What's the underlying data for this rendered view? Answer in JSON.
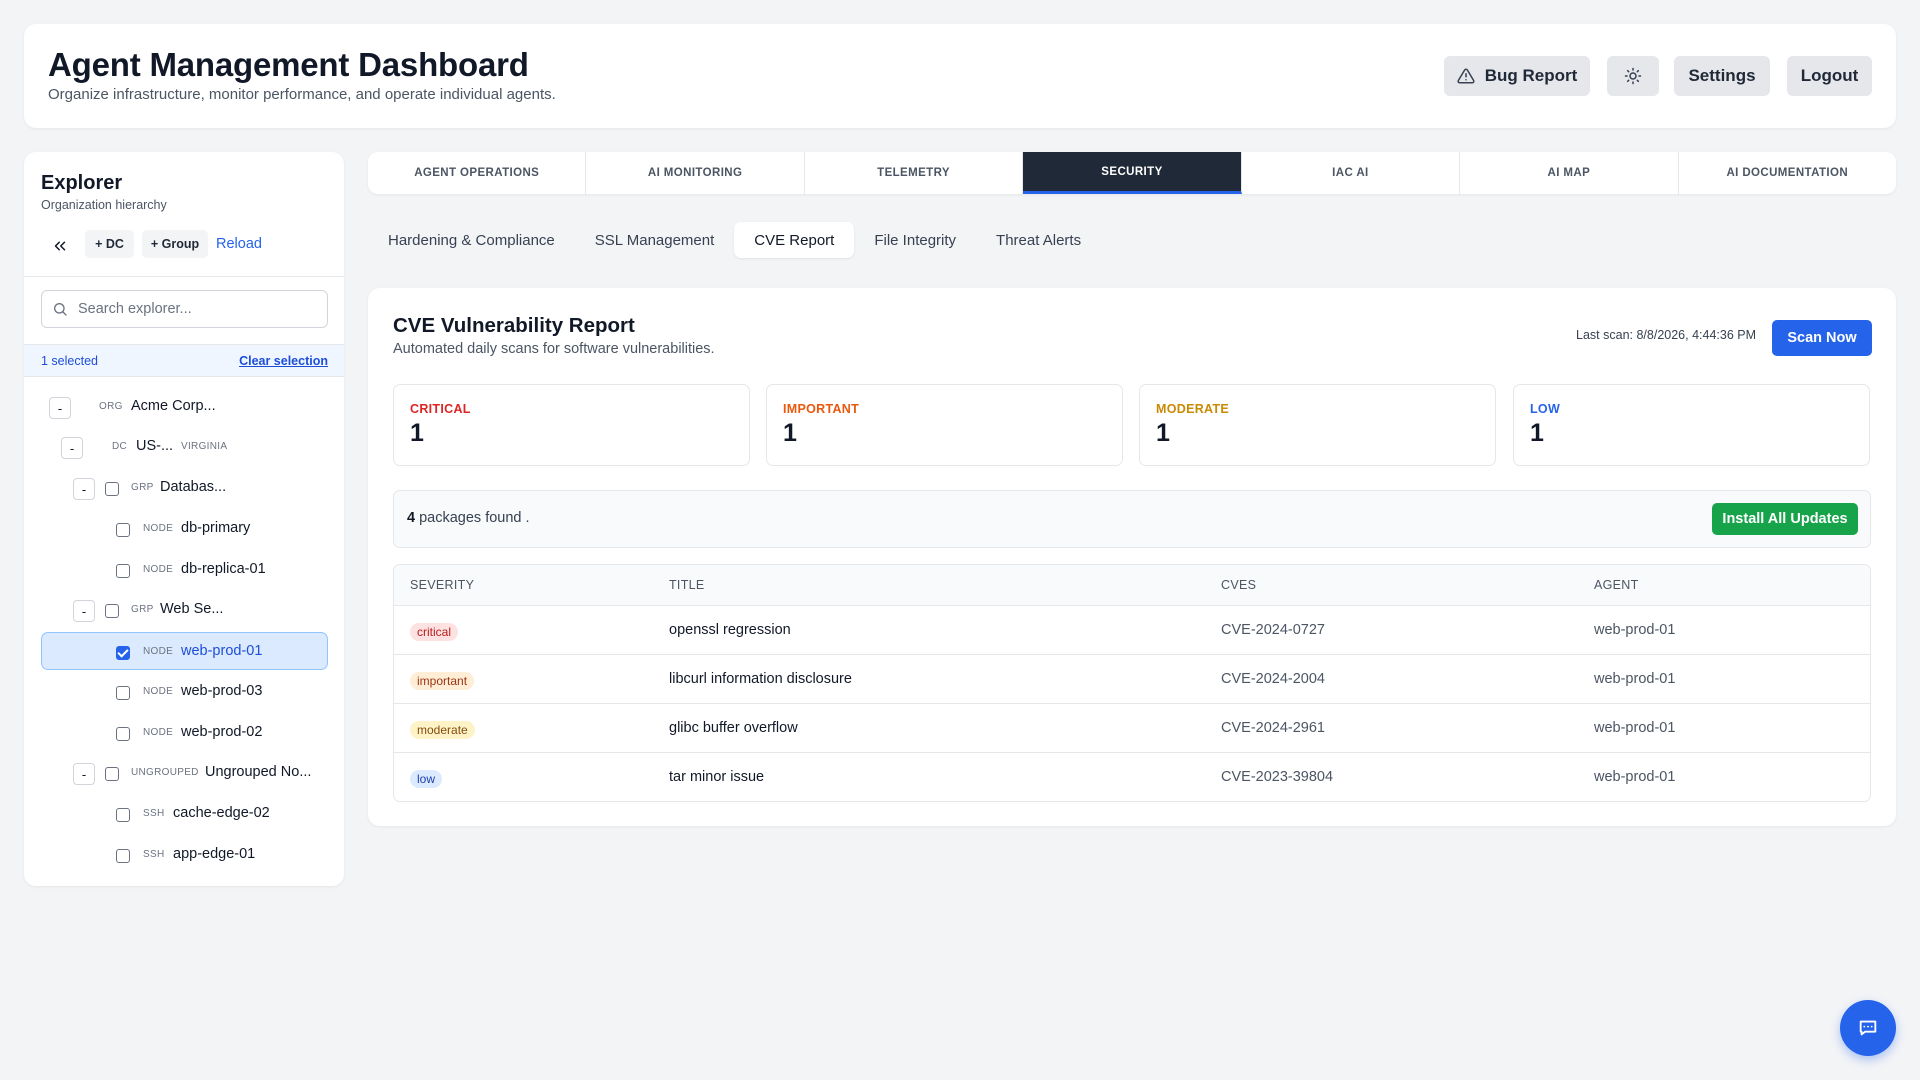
{
  "header": {
    "title": "Agent Management Dashboard",
    "subtitle": "Organize infrastructure, monitor performance, and operate individual agents.",
    "bug_report_label": "Bug Report",
    "settings_label": "Settings",
    "logout_label": "Logout"
  },
  "explorer": {
    "title": "Explorer",
    "subtitle": "Organization hierarchy",
    "add_dc_label": "+ DC",
    "add_group_label": "+ Group",
    "reload_label": "Reload",
    "search_placeholder": "Search explorer...",
    "selected_count": "1 selected",
    "clear_selection_label": "Clear selection",
    "tree": [
      {
        "type": "ORG",
        "label": "Acme Corp...",
        "extra": "",
        "toggle": "-"
      },
      {
        "type": "DC",
        "label": "US-...",
        "extra": "VIRGINIA",
        "toggle": "-"
      },
      {
        "type": "GRP",
        "label": "Databas...",
        "extra": "",
        "toggle": "-"
      },
      {
        "type": "NODE",
        "label": "db-primary",
        "extra": ""
      },
      {
        "type": "NODE",
        "label": "db-replica-01",
        "extra": ""
      },
      {
        "type": "GRP",
        "label": "Web Se...",
        "extra": "",
        "toggle": "-"
      },
      {
        "type": "NODE",
        "label": "web-prod-01",
        "extra": "",
        "checked": true
      },
      {
        "type": "NODE",
        "label": "web-prod-03",
        "extra": ""
      },
      {
        "type": "NODE",
        "label": "web-prod-02",
        "extra": ""
      },
      {
        "type": "UNGROUPED",
        "label": "Ungrouped No...",
        "extra": "",
        "toggle": "-"
      },
      {
        "type": "SSH",
        "label": "cache-edge-02",
        "extra": ""
      },
      {
        "type": "SSH",
        "label": "app-edge-01",
        "extra": ""
      }
    ]
  },
  "tabs": [
    {
      "label": "AGENT OPERATIONS"
    },
    {
      "label": "AI MONITORING"
    },
    {
      "label": "TELEMETRY"
    },
    {
      "label": "SECURITY",
      "active": true
    },
    {
      "label": "IAC AI"
    },
    {
      "label": "AI MAP"
    },
    {
      "label": "AI DOCUMENTATION"
    }
  ],
  "subtabs": [
    {
      "label": "Hardening & Compliance"
    },
    {
      "label": "SSL Management"
    },
    {
      "label": "CVE Report",
      "active": true
    },
    {
      "label": "File Integrity"
    },
    {
      "label": "Threat Alerts"
    }
  ],
  "report": {
    "title": "CVE Vulnerability Report",
    "subtitle": "Automated daily scans for software vulnerabilities.",
    "last_scan": "Last scan: 8/8/2026, 4:44:36 PM",
    "scan_now_label": "Scan Now",
    "stats": [
      {
        "label": "CRITICAL",
        "value": "1",
        "color": "#dc2626"
      },
      {
        "label": "IMPORTANT",
        "value": "1",
        "color": "#ea580c"
      },
      {
        "label": "MODERATE",
        "value": "1",
        "color": "#ca8a04"
      },
      {
        "label": "LOW",
        "value": "1",
        "color": "#2563eb"
      }
    ],
    "packages_count": "4",
    "packages_text": "packages found .",
    "install_all_label": "Install All Updates",
    "columns": [
      "SEVERITY",
      "TITLE",
      "CVES",
      "AGENT"
    ],
    "rows": [
      {
        "severity": "critical",
        "title": "openssl regression",
        "cve": "CVE-2024-0727",
        "agent": "web-prod-01",
        "badge_bg": "#fee2e2",
        "badge_fg": "#b91c1c"
      },
      {
        "severity": "important",
        "title": "libcurl information disclosure",
        "cve": "CVE-2024-2004",
        "agent": "web-prod-01",
        "badge_bg": "#ffedd5",
        "badge_fg": "#9a3412"
      },
      {
        "severity": "moderate",
        "title": "glibc buffer overflow",
        "cve": "CVE-2024-2961",
        "agent": "web-prod-01",
        "badge_bg": "#fef3c7",
        "badge_fg": "#854d0e"
      },
      {
        "severity": "low",
        "title": "tar minor issue",
        "cve": "CVE-2023-39804",
        "agent": "web-prod-01",
        "badge_bg": "#dbeafe",
        "badge_fg": "#1e40af"
      }
    ]
  },
  "colors": {
    "accent": "#2563eb",
    "success": "#16a34a",
    "active_tab_bg": "#1f2937"
  }
}
